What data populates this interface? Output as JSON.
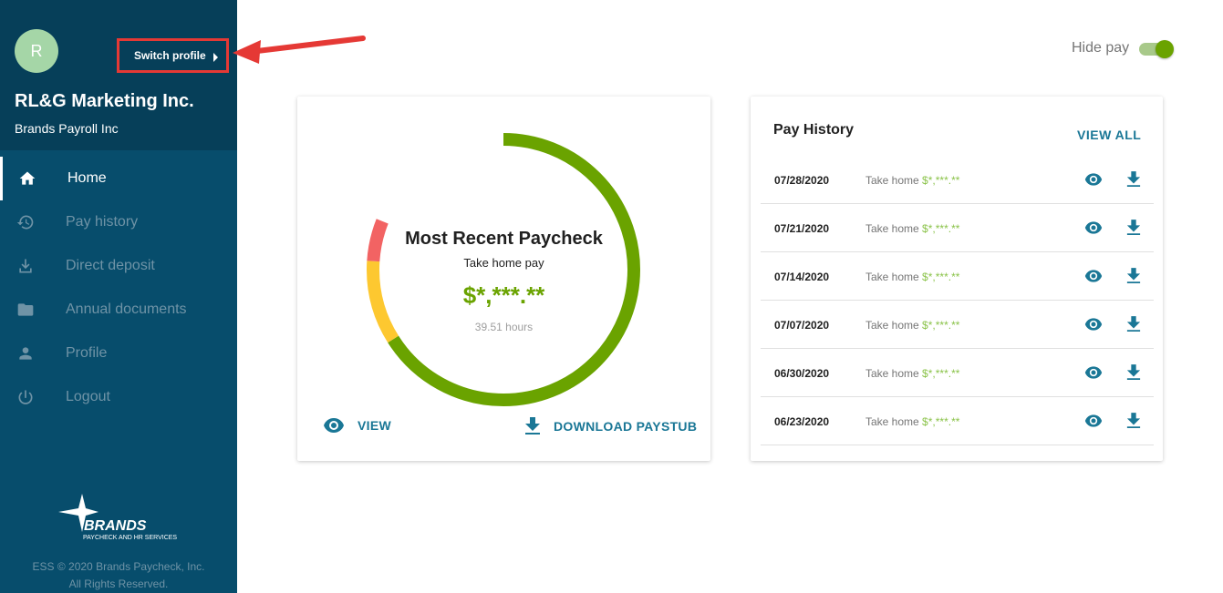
{
  "sidebar": {
    "avatar_letter": "R",
    "switch_profile_label": "Switch profile",
    "company_name": "RL&G Marketing Inc.",
    "company_sub": "Brands Payroll Inc",
    "items": [
      {
        "label": "Home",
        "icon": "home-icon",
        "active": true
      },
      {
        "label": "Pay history",
        "icon": "history-icon",
        "active": false
      },
      {
        "label": "Direct deposit",
        "icon": "download-tray-icon",
        "active": false
      },
      {
        "label": "Annual documents",
        "icon": "folder-icon",
        "active": false
      },
      {
        "label": "Profile",
        "icon": "person-icon",
        "active": false
      },
      {
        "label": "Logout",
        "icon": "power-icon",
        "active": false
      }
    ],
    "logo_text": "BRANDS",
    "logo_tagline": "PAYCHECK AND HR SERVICES",
    "footer_line1": "ESS © 2020 Brands Paycheck, Inc.",
    "footer_line2": "All Rights Reserved."
  },
  "header": {
    "hide_pay_label": "Hide pay",
    "hide_pay_on": true
  },
  "paycheck": {
    "title": "Most Recent Paycheck",
    "subtitle": "Take home pay",
    "amount": "$*,***.**",
    "hours": "39.51 hours",
    "view_label": "VIEW",
    "download_label": "DOWNLOAD PAYSTUB"
  },
  "pay_history": {
    "title": "Pay History",
    "view_all_label": "VIEW ALL",
    "take_home_label": "Take home",
    "rows": [
      {
        "date": "07/28/2020",
        "amount": "$*,***.**"
      },
      {
        "date": "07/21/2020",
        "amount": "$*,***.**"
      },
      {
        "date": "07/14/2020",
        "amount": "$*,***.**"
      },
      {
        "date": "07/07/2020",
        "amount": "$*,***.**"
      },
      {
        "date": "06/30/2020",
        "amount": "$*,***.**"
      },
      {
        "date": "06/23/2020",
        "amount": "$*,***.**"
      }
    ]
  },
  "colors": {
    "sidebar_bg": "#074d6c",
    "sidebar_top_bg": "#063f59",
    "accent_blue": "#1a7796",
    "amount_green": "#6aa300",
    "ring_green": "#6aa300",
    "ring_yellow": "#fdc830",
    "ring_red": "#f26363",
    "annotation_red": "#e53935"
  }
}
